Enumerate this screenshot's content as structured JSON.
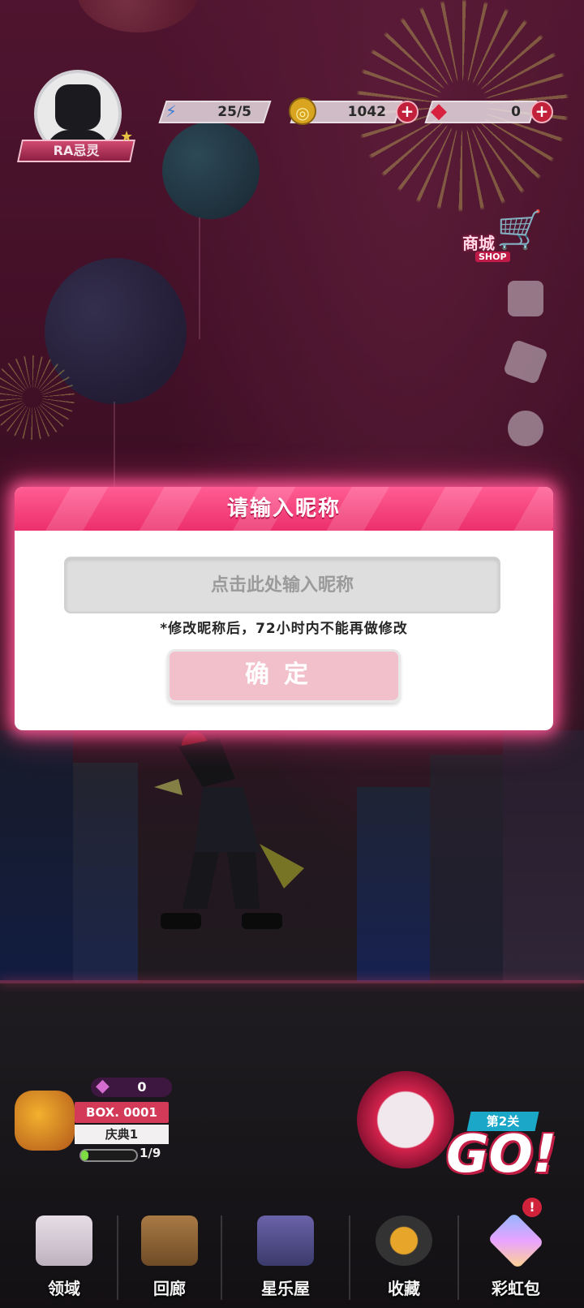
{
  "player": {
    "name": "RA忌灵"
  },
  "resources": [
    {
      "icon": "lightning-icon",
      "value": "25/5"
    },
    {
      "icon": "coin-icon",
      "value": "1042"
    },
    {
      "icon": "ruby-icon",
      "value": "0"
    }
  ],
  "shop": {
    "label": "商城",
    "sub": "SHOP"
  },
  "modal": {
    "title": "请输入昵称",
    "input_placeholder": "点击此处输入昵称",
    "notice": "*修改昵称后，72小时内不能再做修改",
    "confirm_label": "确定"
  },
  "box": {
    "gem_count": "0",
    "title": "BOX. 0001",
    "subtitle": "庆典1",
    "progress": "1/9",
    "progress_fraction": 0.11
  },
  "go": {
    "stage": "第2关",
    "label": "GO!"
  },
  "nav": [
    {
      "label": "领域",
      "icon": "domain-icon"
    },
    {
      "label": "回廊",
      "icon": "gallery-icon"
    },
    {
      "label": "星乐屋",
      "icon": "star-house-icon"
    },
    {
      "label": "收藏",
      "icon": "star-collection-icon"
    },
    {
      "label": "彩虹包",
      "icon": "rainbow-pack-icon"
    }
  ],
  "nav_badge": "!",
  "colors": {
    "accent": "#ec2f6d",
    "confirm_disabled": "#f2c0ca"
  }
}
